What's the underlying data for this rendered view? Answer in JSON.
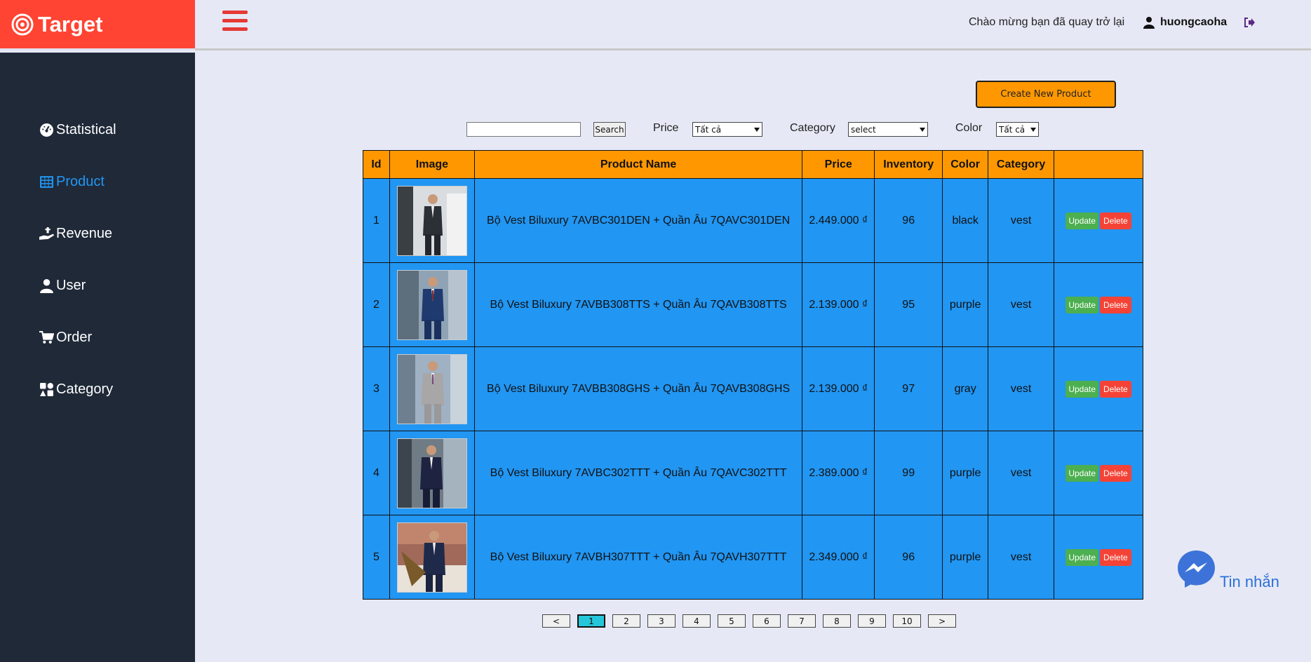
{
  "app": {
    "brand": "Target",
    "welcome": "Chào mừng bạn đã quay trở lại",
    "username": "huongcaoha"
  },
  "sidebar": {
    "items": [
      {
        "label": "Statistical",
        "icon": "dashboard-icon"
      },
      {
        "label": "Product",
        "icon": "table-icon",
        "active": true
      },
      {
        "label": "Revenue",
        "icon": "hand-money-icon"
      },
      {
        "label": "User",
        "icon": "user-icon"
      },
      {
        "label": "Order",
        "icon": "cart-icon"
      },
      {
        "label": "Category",
        "icon": "category-icon"
      }
    ]
  },
  "toolbar": {
    "create_label": "Create New Product",
    "search_value": "",
    "search_label": "Search",
    "price_label": "Price",
    "price_value": "Tất cả",
    "category_label": "Category",
    "category_value": "select",
    "color_label": "Color",
    "color_value": "Tất cả"
  },
  "table": {
    "headers": [
      "Id",
      "Image",
      "Product Name",
      "Price",
      "Inventory",
      "Color",
      "Category",
      ""
    ],
    "update_label": "Update",
    "delete_label": "Delete",
    "rows": [
      {
        "id": "1",
        "name": "Bộ Vest Biluxury 7AVBC301DEN + Quần Âu 7QAVC301DEN",
        "price": "2.449.000 ₫",
        "inventory": "96",
        "color": "black",
        "category": "vest",
        "image": "man-in-dark-suit-photo"
      },
      {
        "id": "2",
        "name": "Bộ Vest Biluxury 7AVBB308TTS + Quần Âu 7QAVB308TTS",
        "price": "2.139.000 ₫",
        "inventory": "95",
        "color": "purple",
        "category": "vest",
        "image": "man-in-navy-suit-photo"
      },
      {
        "id": "3",
        "name": "Bộ Vest Biluxury 7AVBB308GHS + Quần Âu 7QAVB308GHS",
        "price": "2.139.000 ₫",
        "inventory": "97",
        "color": "gray",
        "category": "vest",
        "image": "man-in-gray-suit-photo"
      },
      {
        "id": "4",
        "name": "Bộ Vest Biluxury 7AVBC302TTT + Quần Âu 7QAVC302TTT",
        "price": "2.389.000 ₫",
        "inventory": "99",
        "color": "purple",
        "category": "vest",
        "image": "man-in-navy-suit-photo"
      },
      {
        "id": "5",
        "name": "Bộ Vest Biluxury 7AVBH307TTT + Quần Âu 7QAVH307TTT",
        "price": "2.349.000 ₫",
        "inventory": "96",
        "color": "purple",
        "category": "vest",
        "image": "man-in-navy-suit-photo"
      }
    ]
  },
  "pagination": {
    "prev": "<",
    "pages": [
      "1",
      "2",
      "3",
      "4",
      "5",
      "6",
      "7",
      "8",
      "9",
      "10"
    ],
    "next": ">",
    "active": "1"
  },
  "messenger": {
    "label": "Tin nhắn"
  },
  "colors": {
    "brand": "#ff4433",
    "sidebar_bg": "#1f2938",
    "accent": "#2196f3",
    "table_header": "#ff9800",
    "update": "#4caf50",
    "delete": "#f44336"
  }
}
